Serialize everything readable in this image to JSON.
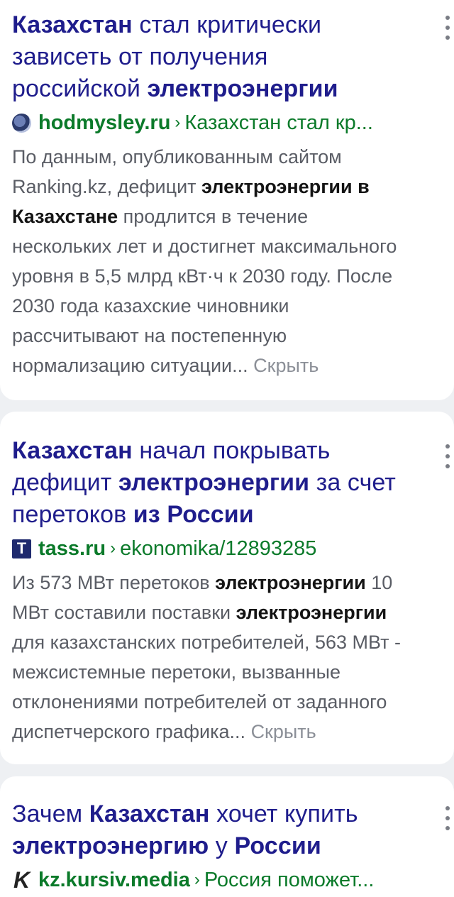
{
  "results": [
    {
      "title_parts": [
        "Казахстан",
        " стал критически",
        "зависеть от получения",
        "российской ",
        "электроэнергии"
      ],
      "favicon": "hodmysley-favicon",
      "domain": "hodmysley.ru",
      "breadcrumb": "Казахстан стал кр...",
      "snippet_lines": {
        "l1": "По данным, опубликованным сайтом",
        "l2a": "Ranking.kz, дефицит ",
        "l2b": "электроэнергии в",
        "l3a": "Казахстане",
        "l3b": " продлится в течение",
        "l4": "нескольких лет и достигнет максимального",
        "l5": "уровня в 5,5 млрд кВт·ч к 2030 году. После",
        "l6": "2030 года казахские чиновники",
        "l7": "рассчитывают на постепенную",
        "l8": "нормализацию ситуации... "
      },
      "hide_label": "Скрыть"
    },
    {
      "title_parts": [
        "Казахстан",
        " начал покрывать",
        "дефицит ",
        "электроэнергии",
        " за счет",
        "перетоков ",
        "из России"
      ],
      "favicon_letter": "Т",
      "domain": "tass.ru",
      "breadcrumb": "ekonomika/12893285",
      "snippet_lines": {
        "l1a": "Из 573 МВт перетоков ",
        "l1b": "электроэнергии",
        "l1c": " 10",
        "l2a": "МВт составили поставки ",
        "l2b": "электроэнергии",
        "l3": "для казахстанских потребителей, 563 МВт -",
        "l4": "межсистемные перетоки, вызванные",
        "l5": "отклонениями потребителей от заданного",
        "l6": "диспетчерского графика... "
      },
      "hide_label": "Скрыть"
    },
    {
      "title_parts": [
        "Зачем ",
        "Казахстан",
        " хочет купить",
        "электроэнергию",
        " у ",
        "России"
      ],
      "favicon_letter": "K",
      "domain": "kz.kursiv.media",
      "breadcrumb": "Россия поможет..."
    }
  ],
  "separator": "›"
}
